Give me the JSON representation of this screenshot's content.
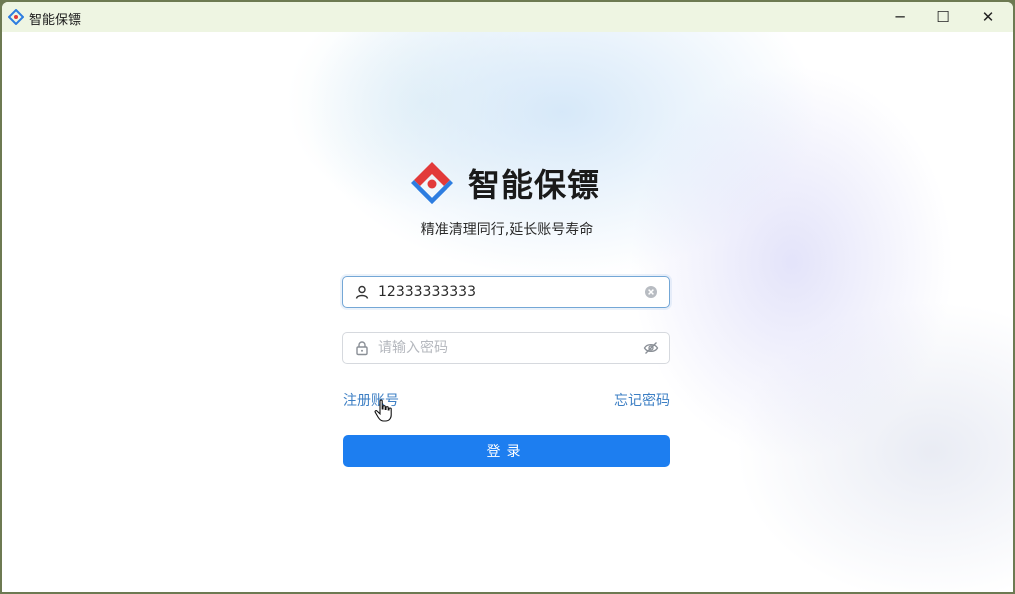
{
  "window": {
    "title": "智能保镖",
    "controls": {
      "minimize": "─",
      "maximize": "☐",
      "close": "✕"
    }
  },
  "brand": {
    "name": "智能保镖",
    "slogan": "精准清理同行,延长账号寿命",
    "logo_colors": {
      "blue": "#2d7de0",
      "red": "#e23a3a"
    }
  },
  "form": {
    "username": {
      "value": "12333333333",
      "icon": "user-icon",
      "clear_icon": "clear-icon"
    },
    "password": {
      "value": "",
      "placeholder": "请输入密码",
      "icon": "lock-icon",
      "toggle_icon": "eye-off-icon"
    },
    "register_link": "注册账号",
    "forgot_link": "忘记密码",
    "login_button": "登录"
  },
  "colors": {
    "accent": "#1d7ef0",
    "link": "#3d7fc4",
    "titlebar": "#eef5e2"
  }
}
